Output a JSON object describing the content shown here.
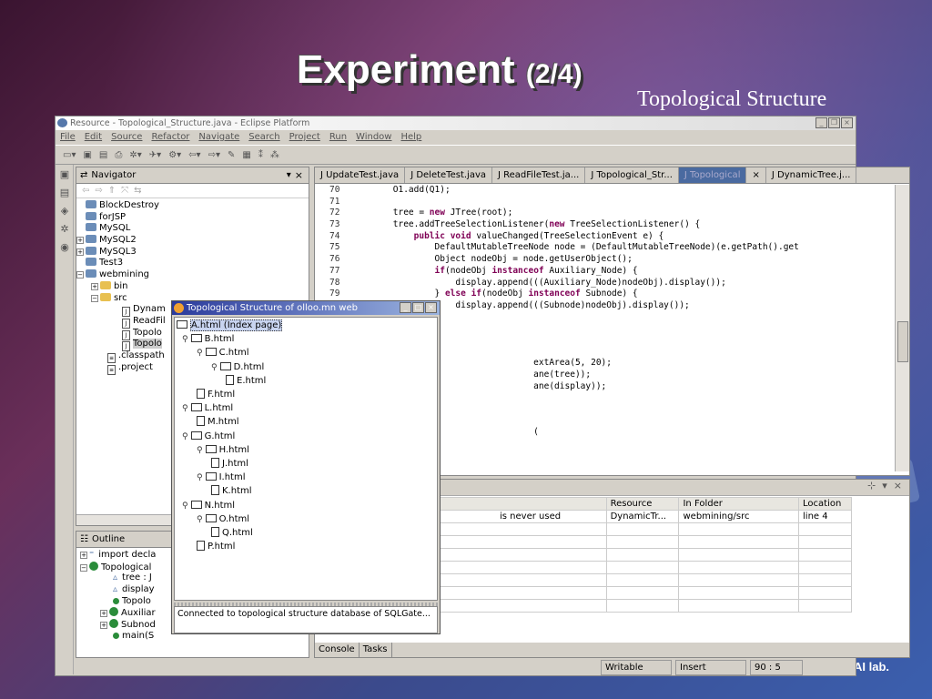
{
  "slide": {
    "title_main": "Experiment",
    "title_part": "(2/4)",
    "subtitle": "Topological Structure",
    "footer": "AI lab."
  },
  "window": {
    "title": "Resource - Topological_Structure.java - Eclipse Platform",
    "menu": [
      "File",
      "Edit",
      "Source",
      "Refactor",
      "Navigate",
      "Search",
      "Project",
      "Run",
      "Window",
      "Help"
    ]
  },
  "navigator": {
    "title": "Navigator",
    "items": [
      "BlockDestroy",
      "forJSP",
      "MySQL",
      "MySQL2",
      "MySQL3",
      "Test3",
      "webmining",
      "bin",
      "src",
      "Dynam",
      "ReadFil",
      "Topolo",
      "Topolo",
      ".classpath",
      ".project"
    ]
  },
  "outline": {
    "title": "Outline",
    "items": [
      "import decla",
      "Topological",
      "tree : J",
      "display",
      "Topolo",
      "Auxiliar",
      "Subnod",
      "main(S"
    ]
  },
  "editor": {
    "tabs": [
      "UpdateTest.java",
      "DeleteTest.java",
      "ReadFileTest.ja...",
      "Topological_Str...",
      "Topological",
      "DynamicTree.j..."
    ],
    "lines": [
      {
        "n": "70",
        "t": "        O1.add(Q1);"
      },
      {
        "n": "71",
        "t": ""
      },
      {
        "n": "72",
        "t": "        tree = new JTree(root);"
      },
      {
        "n": "73",
        "t": "        tree.addTreeSelectionListener(new TreeSelectionListener() {"
      },
      {
        "n": "74",
        "t": "            public void valueChanged(TreeSelectionEvent e) {"
      },
      {
        "n": "75",
        "t": "                DefaultMutableTreeNode node = (DefaultMutableTreeNode)(e.getPath().get"
      },
      {
        "n": "76",
        "t": "                Object nodeObj = node.getUserObject();"
      },
      {
        "n": "77",
        "t": "                if(nodeObj instanceof Auxiliary_Node) {"
      },
      {
        "n": "78",
        "t": "                    display.append(((Auxiliary_Node)nodeObj).display());"
      },
      {
        "n": "79",
        "t": "                } else if(nodeObj instanceof Subnode) {"
      },
      {
        "n": "",
        "t": "                    display.append(((Subnode)nodeObj).display());"
      },
      {
        "n": "",
        "t": ""
      },
      {
        "n": "",
        "t": ""
      },
      {
        "n": "",
        "t": ""
      },
      {
        "n": "",
        "t": ""
      },
      {
        "n": "",
        "t": "                                   extArea(5, 20);"
      },
      {
        "n": "",
        "t": "                                   ane(tree));"
      },
      {
        "n": "",
        "t": "                                   ane(display));"
      },
      {
        "n": "",
        "t": ""
      },
      {
        "n": "",
        "t": ""
      },
      {
        "n": "",
        "t": ""
      },
      {
        "n": "",
        "t": "                                   ("
      }
    ]
  },
  "problems": {
    "columns": [
      "Resource",
      "In Folder",
      "Location"
    ],
    "rows": [
      {
        "desc": "is never used",
        "resource": "DynamicTr...",
        "folder": "webmining/src",
        "location": "line 4"
      }
    ],
    "tabs": [
      "Console",
      "Tasks"
    ]
  },
  "status": [
    "Writable",
    "Insert",
    "90 : 5"
  ],
  "dialog": {
    "title": "Topological Structure of olloo.mn web",
    "nodes": [
      "A.html (Index page)",
      "B.html",
      "C.html",
      "D.html",
      "E.html",
      "F.html",
      "L.html",
      "M.html",
      "G.html",
      "H.html",
      "J.html",
      "I.html",
      "K.html",
      "N.html",
      "O.html",
      "Q.html",
      "P.html"
    ],
    "status": "Connected to topological structure database of SQLGate..."
  }
}
